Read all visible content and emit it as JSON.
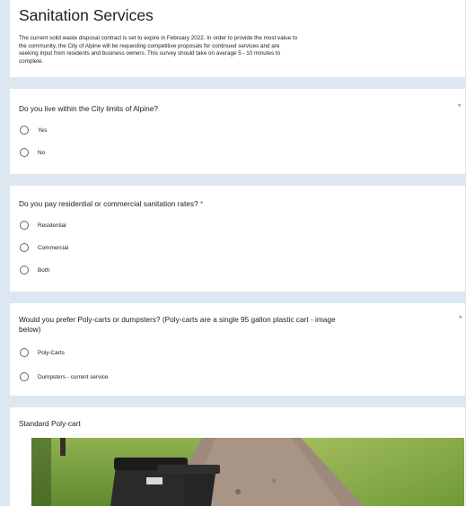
{
  "header": {
    "title": "Sanitation Services",
    "description_lines": [
      "The current solid waste disposal contract is set to expire in February 2022.  In order to provide the most value to",
      "the community, the City of Alpine will be requesting competitive proposals for continued services and are",
      "seeking input from residents and business owners. This survey should take on average 5 - 10 minutes to",
      "complete."
    ]
  },
  "questions": [
    {
      "title": "Do you live within the City limits of Alpine?",
      "required_mark": "*",
      "options": [
        "Yes",
        "No"
      ]
    },
    {
      "title": "Do you pay residential  or commercial sanitation rates?",
      "required_mark": "*",
      "options": [
        "Residential",
        "Commercial",
        "Both"
      ]
    },
    {
      "title_lines": [
        "Would you prefer Poly-carts or dumpsters? (Poly-carts are a single 95 gallon plastic cart - image",
        "below)"
      ],
      "required_mark": "*",
      "options": [
        "Poly-Carts",
        "Dumpsters - current service"
      ]
    }
  ],
  "image_section": {
    "title": "Standard Poly-cart"
  },
  "colors": {
    "accent": "#a8c7e3",
    "background": "#dce7f1",
    "required": "#d93025"
  }
}
